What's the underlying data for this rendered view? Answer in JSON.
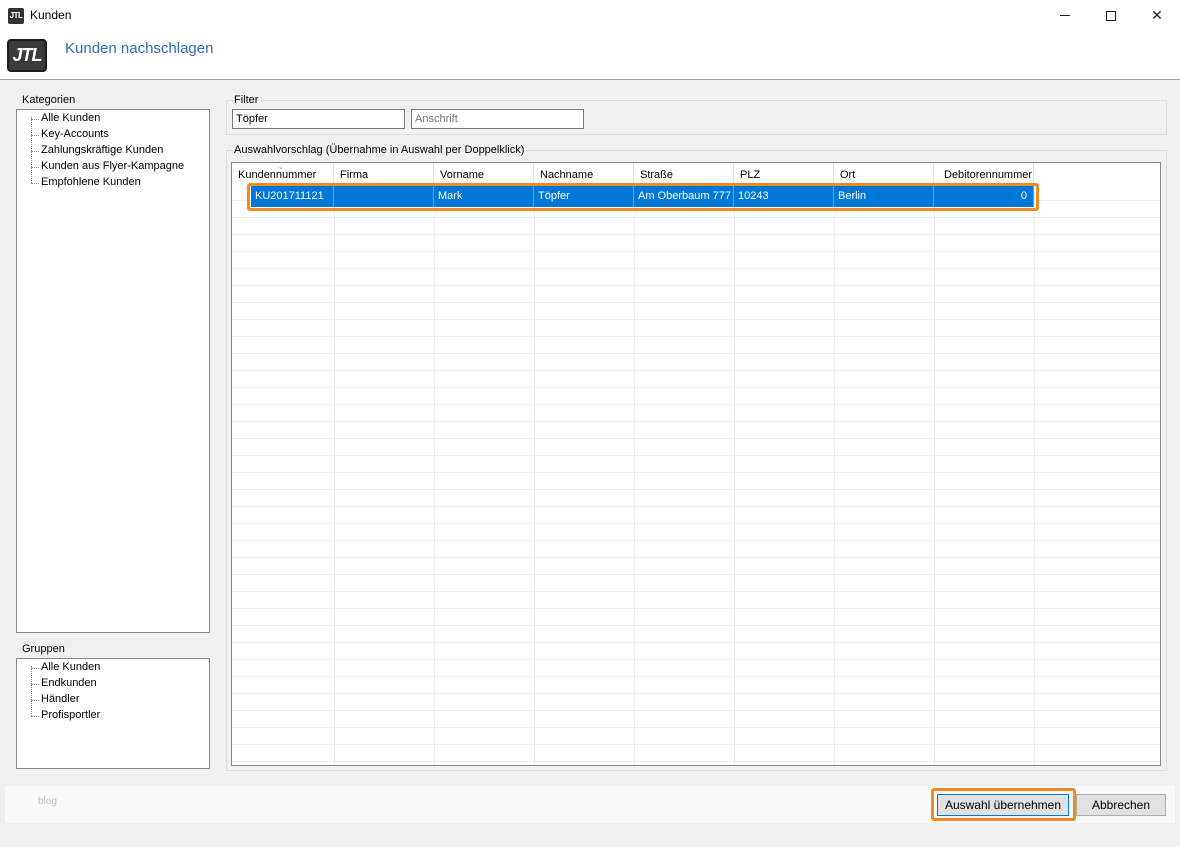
{
  "window": {
    "title": "Kunden",
    "icon_text": "JTL"
  },
  "header": {
    "logo_text": "JTL",
    "title": "Kunden nachschlagen"
  },
  "kategorien": {
    "label": "Kategorien",
    "items": [
      "Alle Kunden",
      "Key-Accounts",
      "Zahlungskräftige Kunden",
      "Kunden aus Flyer-Kampagne",
      "Empfohlene Kunden"
    ]
  },
  "gruppen": {
    "label": "Gruppen",
    "items": [
      "Alle Kunden",
      "Endkunden",
      "Händler",
      "Profisportler"
    ]
  },
  "filter": {
    "label": "Filter",
    "name_value": "Töpfer",
    "address_placeholder": "Anschrift"
  },
  "results": {
    "label": "Auswahlvorschlag (Übernahme in Auswahl per Doppelklick)",
    "columns": [
      "Kundennummer",
      "Firma",
      "Vorname",
      "Nachname",
      "Straße",
      "PLZ",
      "Ort",
      "Debitorennummer"
    ],
    "rows": [
      [
        "KU201711121",
        "",
        "Mark",
        "Töpfer",
        "Am Oberbaum 777",
        "10243",
        "Berlin",
        "0"
      ]
    ]
  },
  "footer": {
    "watermark": "blog",
    "ok_label": "Auswahl übernehmen",
    "cancel_label": "Abbrechen"
  },
  "colors": {
    "accent": "#0078d7",
    "highlight": "#f08a24",
    "title_blue": "#2f6eb5"
  }
}
